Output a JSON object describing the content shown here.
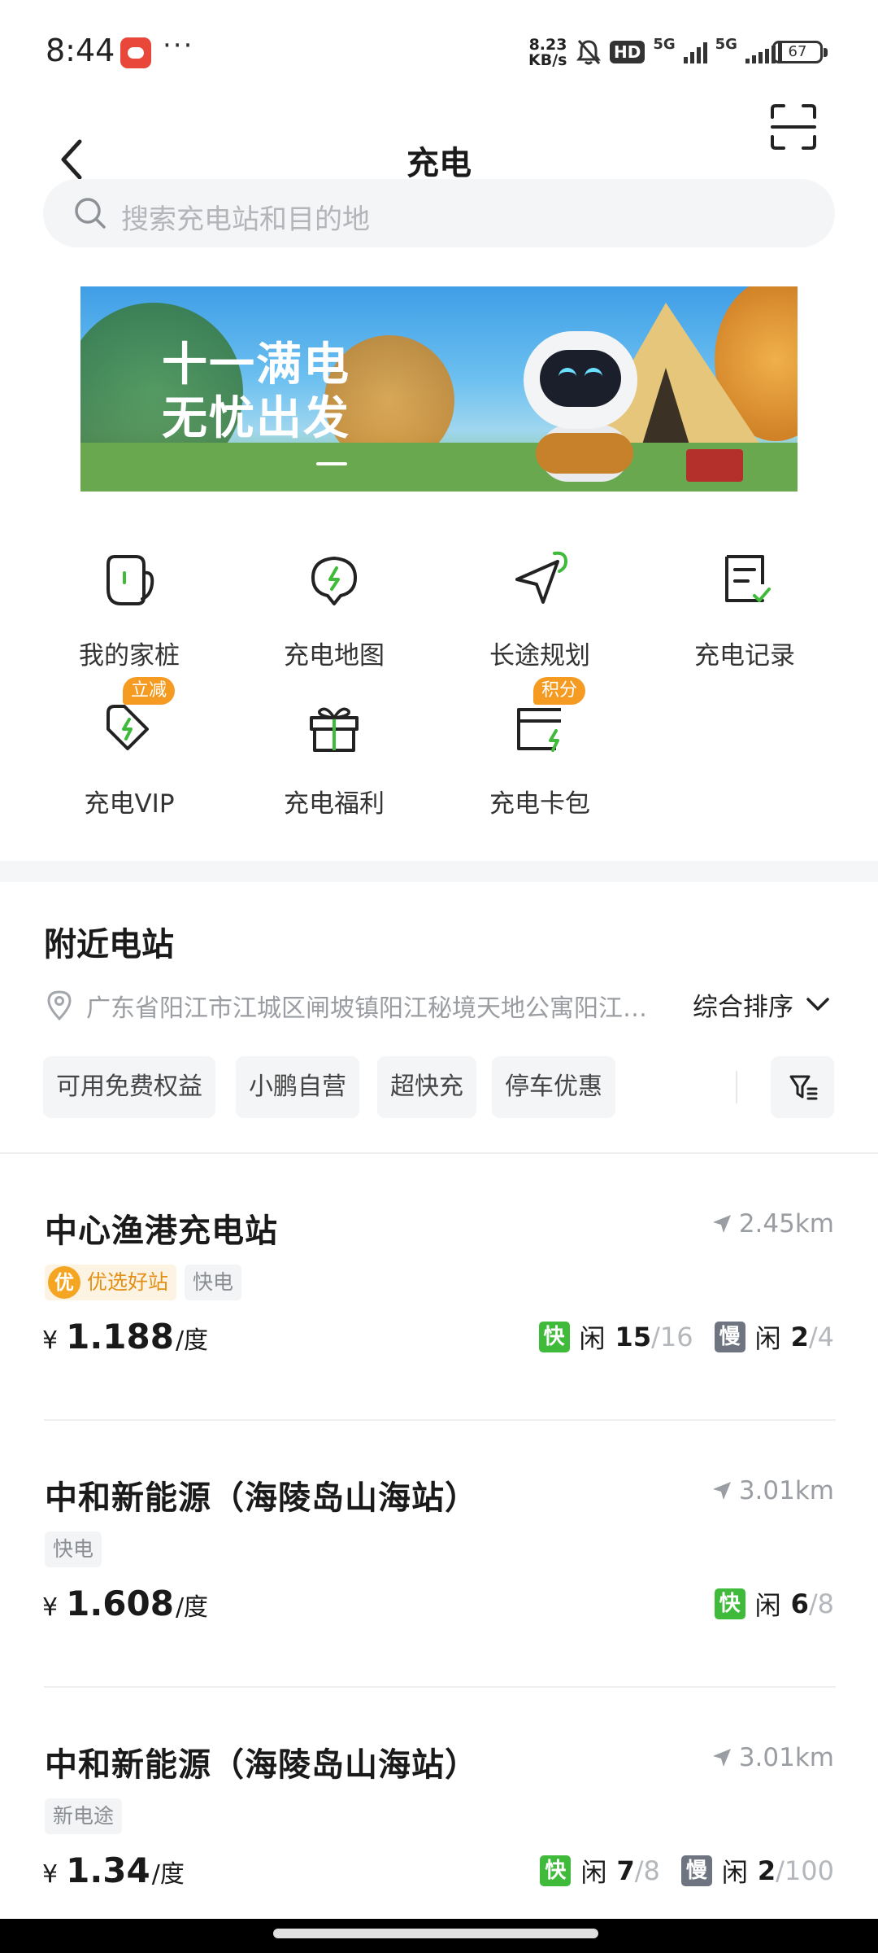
{
  "status_bar": {
    "time": "8:44",
    "more": "···",
    "speed_value": "8.23",
    "speed_unit": "KB/s",
    "hd": "HD",
    "net1": "5G",
    "net2": "5G",
    "battery": "67"
  },
  "header": {
    "title": "充电",
    "back_icon": "back-arrow-icon",
    "scan_icon": "scan-icon"
  },
  "search": {
    "placeholder": "搜索充电站和目的地"
  },
  "banner": {
    "line1": "十一满电",
    "line2": "无忧出发"
  },
  "quick_menu": {
    "items": [
      {
        "label": "我的家桩",
        "icon": "home-charger-icon",
        "badge": ""
      },
      {
        "label": "充电地图",
        "icon": "charge-map-icon",
        "badge": ""
      },
      {
        "label": "长途规划",
        "icon": "route-plan-icon",
        "badge": ""
      },
      {
        "label": "充电记录",
        "icon": "charge-record-icon",
        "badge": ""
      },
      {
        "label": "充电VIP",
        "icon": "vip-tag-icon",
        "badge": "立减"
      },
      {
        "label": "充电福利",
        "icon": "gift-icon",
        "badge": ""
      },
      {
        "label": "充电卡包",
        "icon": "card-wallet-icon",
        "badge": "积分"
      }
    ]
  },
  "nearby": {
    "title": "附近电站",
    "location": "广东省阳江市江城区闸坡镇阳江秘境天地公寓阳江秘境天地",
    "sort_label": "综合排序",
    "filters": [
      "可用免费权益",
      "小鹏自营",
      "超快充",
      "停车优惠"
    ]
  },
  "stations": [
    {
      "name": "中心渔港充电站",
      "distance": "2.45km",
      "good_tag_icon": "优",
      "tags": [
        "优选好站",
        "快电"
      ],
      "currency": "¥",
      "price": "1.188",
      "unit": "/度",
      "fast": {
        "badge": "快",
        "idle": "闲",
        "free": "15",
        "total": "/16"
      },
      "slow": {
        "badge": "慢",
        "idle": "闲",
        "free": "2",
        "total": "/4"
      }
    },
    {
      "name": "中和新能源（海陵岛山海站）",
      "distance": "3.01km",
      "tags": [
        "快电"
      ],
      "currency": "¥",
      "price": "1.608",
      "unit": "/度",
      "fast": {
        "badge": "快",
        "idle": "闲",
        "free": "6",
        "total": "/8"
      }
    },
    {
      "name": "中和新能源（海陵岛山海站）",
      "distance": "3.01km",
      "tags": [
        "新电途"
      ],
      "currency": "¥",
      "price": "1.34",
      "unit": "/度",
      "fast": {
        "badge": "快",
        "idle": "闲",
        "free": "7",
        "total": "/8"
      },
      "slow": {
        "badge": "慢",
        "idle": "闲",
        "free": "2",
        "total": "/100"
      }
    }
  ],
  "colors": {
    "accent_green": "#3fba3a",
    "badge_orange": "#f59b22",
    "slow_gray": "#6e7580"
  }
}
